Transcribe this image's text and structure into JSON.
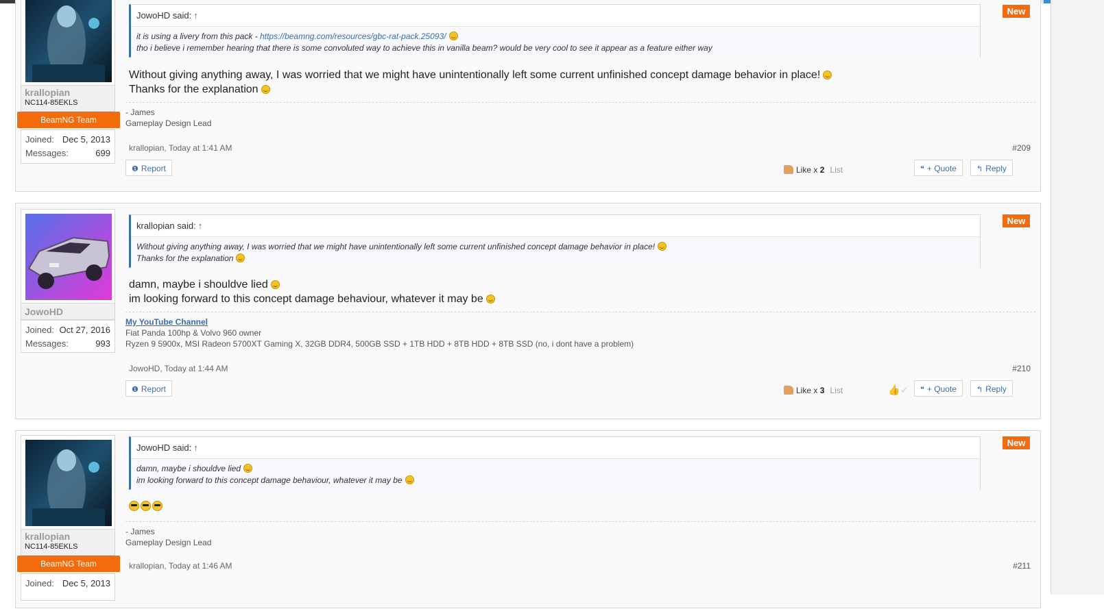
{
  "posts": [
    {
      "user": {
        "name": "krallopian",
        "title": "NC114-85EKLS",
        "team": "BeamNG Team",
        "joined_label": "Joined:",
        "joined": "Dec 5, 2013",
        "messages_label": "Messages:",
        "messages": "699"
      },
      "quote": {
        "author": "JowoHD said:",
        "arrow": "↑",
        "line1_prefix": "it is using a livery from this pack - ",
        "link": "https://beamng.com/resources/gbc-rat-pack.25093/",
        "line2": "tho i believe i remember hearing that there is some convoluted way to achieve this in vanilla beam? would be very cool to see it appear as a feature either way"
      },
      "badge": "New",
      "message": [
        "Without giving anything away, I was worried that we might have unintentionally left some current unfinished concept damage behavior in place!",
        "Thanks for the explanation"
      ],
      "signature": [
        "- James",
        "Gameplay Design Lead"
      ],
      "meta": "krallopian, Today at 1:41 AM",
      "number": "#209",
      "report": "Report",
      "like": "Like x",
      "like_count": "2",
      "list": "List",
      "quote_btn": "+ Quote",
      "reply_btn": "Reply"
    },
    {
      "user": {
        "name": "JowoHD",
        "joined_label": "Joined:",
        "joined": "Oct 27, 2016",
        "messages_label": "Messages:",
        "messages": "993"
      },
      "quote": {
        "author": "krallopian said:",
        "arrow": "↑",
        "line1": "Without giving anything away, I was worried that we might have unintentionally left some current unfinished concept damage behavior in place!",
        "line2": "Thanks for the explanation"
      },
      "badge": "New",
      "message": [
        "damn, maybe i shouldve lied",
        "im looking forward to this concept damage behaviour, whatever it may be"
      ],
      "signature": {
        "link": "My YouTube Channel",
        "line2": "Fiat Panda 100hp & Volvo 960 owner",
        "line3": "Ryzen 9 5900x, MSI Radeon 5700XT Gaming X, 32GB DDR4, 500GB SSD + 1TB HDD + 8TB HDD + 8TB SSD (no, i dont have a problem)"
      },
      "meta": "JowoHD, Today at 1:44 AM",
      "number": "#210",
      "report": "Report",
      "like": "Like x",
      "like_count": "3",
      "list": "List",
      "quote_btn": "+ Quote",
      "reply_btn": "Reply"
    },
    {
      "user": {
        "name": "krallopian",
        "title": "NC114-85EKLS",
        "team": "BeamNG Team",
        "joined_label": "Joined:",
        "joined": "Dec 5, 2013"
      },
      "quote": {
        "author": "JowoHD said:",
        "arrow": "↑",
        "line1": "damn, maybe i shouldve lied",
        "line2": "im looking forward to this concept damage behaviour, whatever it may be"
      },
      "badge": "New",
      "signature": [
        "- James",
        "Gameplay Design Lead"
      ],
      "meta": "krallopian, Today at 1:46 AM",
      "number": "#211"
    }
  ],
  "colors": {
    "accent": "#f26c0d",
    "link": "#3b6ea5"
  },
  "icons": {
    "report": "info-circle-icon",
    "quote": "quote-icon",
    "reply": "reply-icon",
    "like": "thumbs-up-icon",
    "smiley": "smiley-icon",
    "cool": "sunglasses-smiley-icon"
  }
}
